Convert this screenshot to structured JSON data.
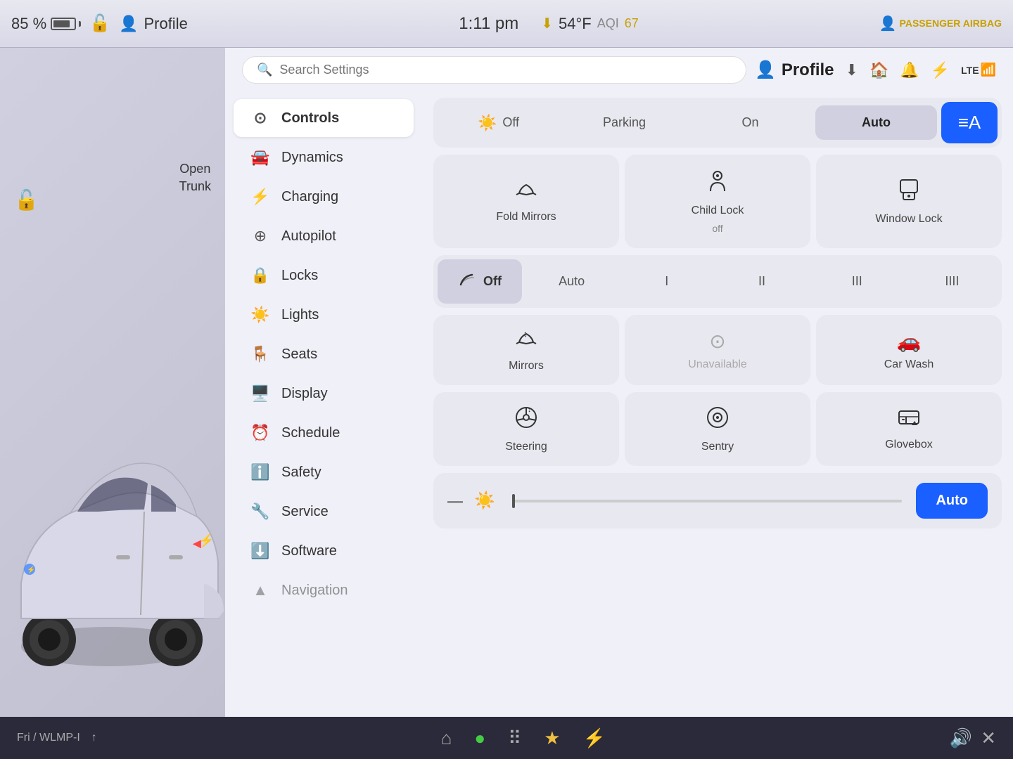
{
  "topbar": {
    "battery_percent": "85 %",
    "lock_icon": "🔒",
    "profile_icon": "👤",
    "profile_label": "Profile",
    "time": "1:11 pm",
    "download_icon": "⬇",
    "temp": "54°F",
    "aqi_label": "AQI",
    "aqi_value": "67",
    "passenger_airbag": "PASSENGER AIRBAG"
  },
  "search": {
    "placeholder": "Search Settings"
  },
  "header": {
    "profile_label": "Profile",
    "lte_label": "LTE"
  },
  "car": {
    "open_trunk": "Open\nTrunk"
  },
  "sidebar": {
    "items": [
      {
        "id": "controls",
        "label": "Controls",
        "icon": "⊙",
        "active": true
      },
      {
        "id": "dynamics",
        "label": "Dynamics",
        "icon": "🚗"
      },
      {
        "id": "charging",
        "label": "Charging",
        "icon": "⚡"
      },
      {
        "id": "autopilot",
        "label": "Autopilot",
        "icon": "⊕"
      },
      {
        "id": "locks",
        "label": "Locks",
        "icon": "🔒"
      },
      {
        "id": "lights",
        "label": "Lights",
        "icon": "☀"
      },
      {
        "id": "seats",
        "label": "Seats",
        "icon": "🪑"
      },
      {
        "id": "display",
        "label": "Display",
        "icon": "🖥"
      },
      {
        "id": "schedule",
        "label": "Schedule",
        "icon": "⏰"
      },
      {
        "id": "safety",
        "label": "Safety",
        "icon": "ℹ"
      },
      {
        "id": "service",
        "label": "Service",
        "icon": "🔧"
      },
      {
        "id": "software",
        "label": "Software",
        "icon": "⬇"
      },
      {
        "id": "navigation",
        "label": "Navigation",
        "icon": "▲"
      }
    ]
  },
  "lights": {
    "off_label": "Off",
    "parking_label": "Parking",
    "on_label": "On",
    "auto_label": "Auto"
  },
  "window_controls": {
    "fold_mirrors_label": "Fold Mirrors",
    "child_lock_label": "Child Lock",
    "child_lock_sub": "off",
    "window_lock_label": "Window Lock"
  },
  "wipers": {
    "off_label": "Off",
    "auto_label": "Auto",
    "speed1": "I",
    "speed2": "II",
    "speed3": "III",
    "speed4": "IIII"
  },
  "bottom_controls": {
    "mirrors_label": "Mirrors",
    "unavailable_label": "Unavailable",
    "car_wash_label": "Car Wash",
    "steering_label": "Steering",
    "sentry_label": "Sentry",
    "glovebox_label": "Glovebox"
  },
  "brightness": {
    "auto_label": "Auto"
  },
  "taskbar": {
    "route_info": "Fri / WLMP-I",
    "arrow": "↑"
  }
}
